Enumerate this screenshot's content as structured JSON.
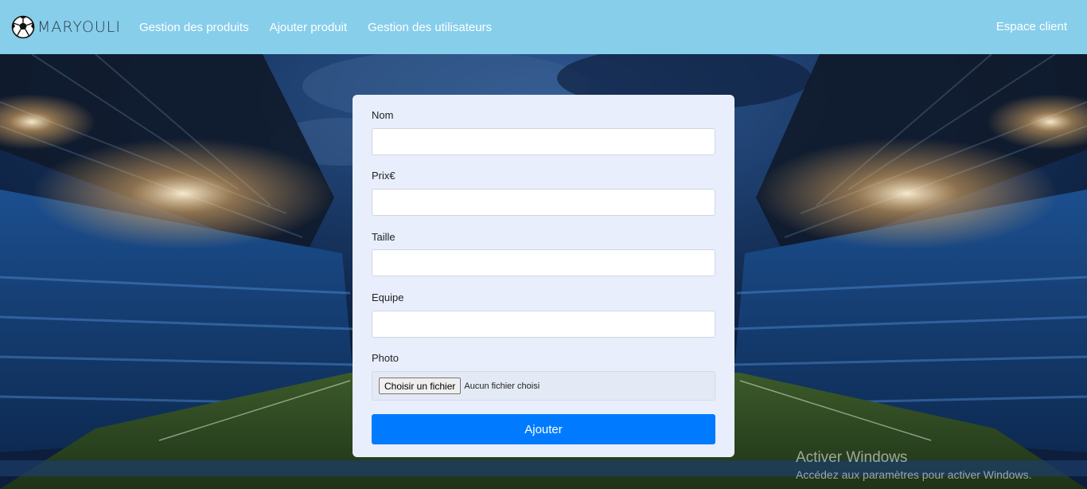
{
  "navbar": {
    "brand": "MARYOULI",
    "links": [
      "Gestion des produits",
      "Ajouter produit",
      "Gestion des utilisateurs"
    ],
    "right_link": "Espace client",
    "background_color": "#87ceeb"
  },
  "form": {
    "fields": [
      {
        "label": "Nom",
        "value": ""
      },
      {
        "label": "Prix€",
        "value": ""
      },
      {
        "label": "Taille",
        "value": ""
      },
      {
        "label": "Equipe",
        "value": ""
      }
    ],
    "photo": {
      "label": "Photo",
      "button": "Choisir un fichier",
      "status": "Aucun fichier choisi"
    },
    "submit_label": "Ajouter",
    "submit_color": "#007bff"
  },
  "watermark": {
    "title": "Activer Windows",
    "subtitle": "Accédez aux paramètres pour activer Windows."
  },
  "icons": {
    "brand_logo": "soccer-ball-icon"
  }
}
